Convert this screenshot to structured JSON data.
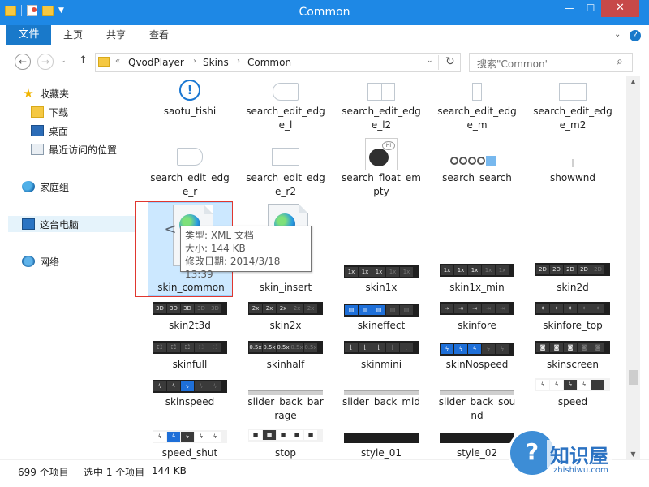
{
  "window": {
    "title": "Common",
    "buttons": {
      "minimize": "—",
      "maximize": "☐",
      "close": "✕"
    }
  },
  "ribbon": {
    "file_tab": "文件",
    "tabs": [
      "主页",
      "共享",
      "查看"
    ],
    "help": "?"
  },
  "nav": {
    "back": "←",
    "forward": "→",
    "recent": "⌄",
    "up": "↑",
    "breadcrumb_prefix": "«",
    "breadcrumbs": [
      "QvodPlayer",
      "Skins",
      "Common"
    ],
    "separator": "›",
    "refresh": "↻",
    "dropdown": "⌄"
  },
  "search": {
    "placeholder": "搜索\"Common\"",
    "icon": "⌕"
  },
  "sidebar": {
    "items": [
      {
        "label": "收藏夹",
        "icon": "star-icon"
      },
      {
        "label": "下载",
        "icon": "downloads-icon"
      },
      {
        "label": "桌面",
        "icon": "desktop-icon"
      },
      {
        "label": "最近访问的位置",
        "icon": "recent-places-icon"
      },
      {
        "label": "家庭组",
        "icon": "homegroup-icon"
      },
      {
        "label": "这台电脑",
        "icon": "this-pc-icon"
      },
      {
        "label": "网络",
        "icon": "network-icon"
      }
    ]
  },
  "files": [
    {
      "line1": "saotu_tishi",
      "line2": ""
    },
    {
      "line1": "search_edit_edg",
      "line2": "e_l"
    },
    {
      "line1": "search_edit_edg",
      "line2": "e_l2"
    },
    {
      "line1": "search_edit_edg",
      "line2": "e_m"
    },
    {
      "line1": "search_edit_edg",
      "line2": "e_m2"
    },
    {
      "line1": "search_edit_edg",
      "line2": "e_r"
    },
    {
      "line1": "search_edit_edg",
      "line2": "e_r2"
    },
    {
      "line1": "search_float_em",
      "line2": "pty"
    },
    {
      "line1": "search_search",
      "line2": ""
    },
    {
      "line1": "showwnd",
      "line2": ""
    },
    {
      "line1": "skin_common",
      "line2": ""
    },
    {
      "line1": "skin_insert",
      "line2": ""
    },
    {
      "line1": "skin1x",
      "line2": ""
    },
    {
      "line1": "skin1x_min",
      "line2": ""
    },
    {
      "line1": "skin2d",
      "line2": ""
    },
    {
      "line1": "skin2t3d",
      "line2": ""
    },
    {
      "line1": "skin2x",
      "line2": ""
    },
    {
      "line1": "skineffect",
      "line2": ""
    },
    {
      "line1": "skinfore",
      "line2": ""
    },
    {
      "line1": "skinfore_top",
      "line2": ""
    },
    {
      "line1": "skinfull",
      "line2": ""
    },
    {
      "line1": "skinhalf",
      "line2": ""
    },
    {
      "line1": "skinmini",
      "line2": ""
    },
    {
      "line1": "skinNospeed",
      "line2": ""
    },
    {
      "line1": "skinscreen",
      "line2": ""
    },
    {
      "line1": "skinspeed",
      "line2": ""
    },
    {
      "line1": "slider_back_bar",
      "line2": "rage"
    },
    {
      "line1": "slider_back_mid",
      "line2": ""
    },
    {
      "line1": "slider_back_sou",
      "line2": "nd"
    },
    {
      "line1": "speed",
      "line2": ""
    },
    {
      "line1": "speed_shut",
      "line2": ""
    },
    {
      "line1": "stop",
      "line2": ""
    },
    {
      "line1": "style_01",
      "line2": ""
    },
    {
      "line1": "style_02",
      "line2": ""
    }
  ],
  "thumb_text": {
    "skin1x": "1x",
    "skin2d": "2D",
    "skin2t3d": "3D",
    "skin2x": "2x",
    "skinhalf": "0.5x",
    "xml_bracket": "<",
    "float_bubble": "Hi"
  },
  "tooltip": {
    "type": "类型: XML 文档",
    "size": "大小: 144 KB",
    "modified": "修改日期: 2014/3/18 13:39"
  },
  "statusbar": {
    "count": "699 个项目",
    "selected": "选中 1 个项目",
    "size": "144 KB"
  },
  "watermark": {
    "symbol": "?",
    "brand": "知识屋",
    "sub": "zhishiwu.com"
  },
  "colors": {
    "titlebar": "#1e88e5",
    "file_tab": "#1979ca",
    "close": "#c74949",
    "selection": "#cce8ff",
    "highlight_box": "#e0372f"
  }
}
